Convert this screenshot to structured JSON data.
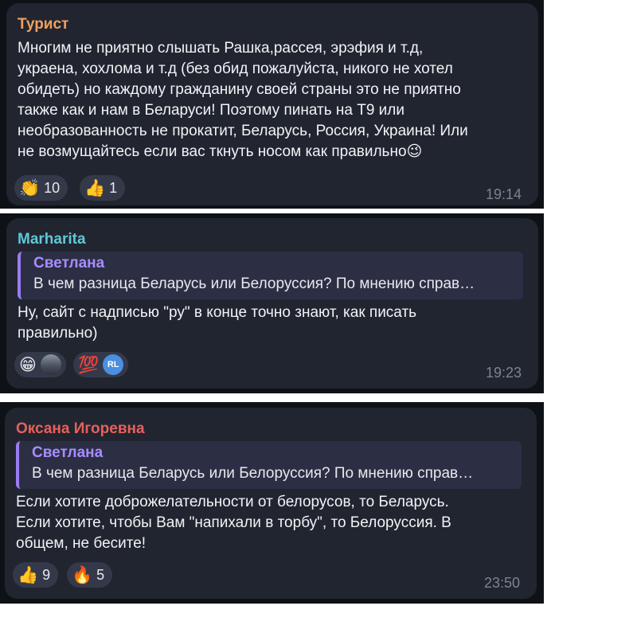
{
  "messages": [
    {
      "author": "Турист",
      "author_color": "#f0a060",
      "text": "Многим не приятно слышать Рашка,рассея, эрэфия и т.д,\nукраена, хохлома и т.д (без обид пожалуйста, никого не хотел\nобидеть) но каждому гражданину своей страны это не приятно\nтакже как и нам в Беларуси! Поэтому пинать на Т9 или\nнеобразованность не прокатит, Беларусь, Россия, Украина! Или\nне возмущайтесь если вас ткнуть носом как правильно😉",
      "reactions": [
        {
          "icon": "clapping-hands-icon",
          "emoji": "👏",
          "count": "10"
        },
        {
          "icon": "thumbs-up-icon",
          "emoji": "👍",
          "count": "1"
        }
      ],
      "time": "19:14"
    },
    {
      "author": "Marharita",
      "author_color": "#5fc8d8",
      "quote": {
        "author": "Светлана",
        "text": "В чем разница Беларусь или Белоруссия? По мнению справ…"
      },
      "text": "Ну, сайт с надписью \"ру\" в конце точно знают, как писать\nправильно)",
      "reactions": [
        {
          "icon": "grinning-face-icon",
          "emoji": "😁",
          "avatar": "car-avatar"
        },
        {
          "icon": "hundred-points-icon",
          "emoji": "💯",
          "avatar_initials": "RL"
        }
      ],
      "time": "19:23"
    },
    {
      "author": "Оксана Игоревна",
      "author_color": "#e8605c",
      "quote": {
        "author": "Светлана",
        "text": "В чем разница Беларусь или Белоруссия? По мнению справ…"
      },
      "text": "Если хотите доброжелательности от белорусов, то Беларусь.\nЕсли хотите, чтобы Вам \"напихали в торбу\", то Белоруссия. В\nобщем, не бесите!",
      "reactions": [
        {
          "icon": "thumbs-up-icon",
          "emoji": "👍",
          "count": "9"
        },
        {
          "icon": "fire-icon",
          "emoji": "🔥",
          "count": "5"
        }
      ],
      "time": "23:50"
    }
  ]
}
